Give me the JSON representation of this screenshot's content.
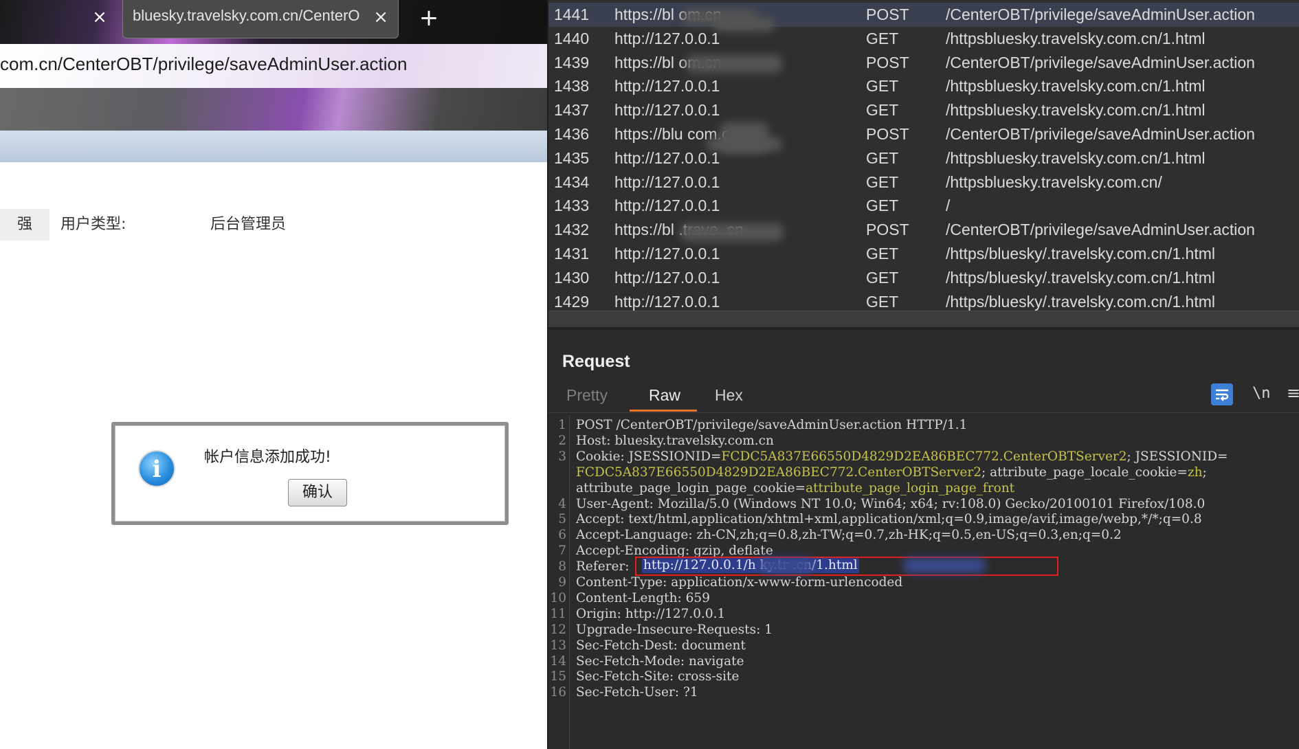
{
  "browser": {
    "tab_close_glyph": "×",
    "active_tab_title": "bluesky.travelsky.com.cn/CenterOBT/privilege/saveAdminUser.action",
    "active_tab_close_glyph": "×",
    "new_tab_glyph": "+",
    "url": "com.cn/CenterOBT/privilege/saveAdminUser.action",
    "form": {
      "left_label": "强",
      "label": "用户类型:",
      "value": "后台管理员"
    },
    "dialog": {
      "icon_glyph": "i",
      "message": "帐户信息添加成功!",
      "ok_label": "确认"
    }
  },
  "burp": {
    "history": [
      {
        "id": "1441",
        "host": "https://bl            om.cn",
        "method": "POST",
        "path": "/CenterOBT/privilege/saveAdminUser.action",
        "selected": true
      },
      {
        "id": "1440",
        "host": "http://127.0.0.1",
        "method": "GET",
        "path": "/httpsbluesky.travelsky.com.cn/1.html"
      },
      {
        "id": "1439",
        "host": "https://bl             om.cn",
        "method": "POST",
        "path": "/CenterOBT/privilege/saveAdminUser.action"
      },
      {
        "id": "1438",
        "host": "http://127.0.0.1",
        "method": "GET",
        "path": "/httpsbluesky.travelsky.com.cn/1.html"
      },
      {
        "id": "1437",
        "host": "http://127.0.0.1",
        "method": "GET",
        "path": "/httpsbluesky.travelsky.com.cn/1.html"
      },
      {
        "id": "1436",
        "host": "https://blu            com.cn",
        "method": "POST",
        "path": "/CenterOBT/privilege/saveAdminUser.action"
      },
      {
        "id": "1435",
        "host": "http://127.0.0.1",
        "method": "GET",
        "path": "/httpsbluesky.travelsky.com.cn/1.html"
      },
      {
        "id": "1434",
        "host": "http://127.0.0.1",
        "method": "GET",
        "path": "/httpsbluesky.travelsky.com.cn/"
      },
      {
        "id": "1433",
        "host": "http://127.0.0.1",
        "method": "GET",
        "path": "/"
      },
      {
        "id": "1432",
        "host": "https://bl      .trave      .cn",
        "method": "POST",
        "path": "/CenterOBT/privilege/saveAdminUser.action"
      },
      {
        "id": "1431",
        "host": "http://127.0.0.1",
        "method": "GET",
        "path": "/https/bluesky/.travelsky.com.cn/1.html"
      },
      {
        "id": "1430",
        "host": "http://127.0.0.1",
        "method": "GET",
        "path": "/https/bluesky/.travelsky.com.cn/1.html"
      },
      {
        "id": "1429",
        "host": "http://127.0.0.1",
        "method": "GET",
        "path": "/https/bluesky/.travelsky.com.cn/1.html"
      }
    ],
    "request_title": "Request",
    "tabs": {
      "pretty": "Pretty",
      "raw": "Raw",
      "hex": "Hex"
    },
    "newline_toggle": "\\n",
    "menu_glyph": "≡",
    "raw_lines": [
      {
        "n": "1",
        "k": "POST /CenterOBT/privilege/saveAdminUser.action HTTP/1.1"
      },
      {
        "n": "2",
        "k": "Host: ",
        "v": "bluesky.travelsky.com.cn"
      },
      {
        "n": "3",
        "k": "Cookie: ",
        "cn1": "JSESSIONID=",
        "cv1": "FCDC5A837E66550D4829D2EA86BEC772.CenterOBTServer2",
        "cn2": "; JSESSIONID="
      },
      {
        "n": "",
        "cv1": "FCDC5A837E66550D4829D2EA86BEC772.CenterOBTServer2",
        "cn2": "; attribute_page_locale_cookie=",
        "cv2": "zh",
        "cn3": ";"
      },
      {
        "n": "",
        "cn1": "attribute_page_login_page_cookie=",
        "cv1": "attribute_page_login_page_front"
      },
      {
        "n": "4",
        "k": "User-Agent: ",
        "v": "Mozilla/5.0 (Windows NT 10.0; Win64; x64; rv:108.0) Gecko/20100101 Firefox/108.0"
      },
      {
        "n": "5",
        "k": "Accept: ",
        "v": "text/html,application/xhtml+xml,application/xml;q=0.9,image/avif,image/webp,*/*;q=0.8"
      },
      {
        "n": "6",
        "k": "Accept-Language: ",
        "v": "zh-CN,zh;q=0.8,zh-TW;q=0.7,zh-HK;q=0.5,en-US;q=0.3,en;q=0.2"
      },
      {
        "n": "7",
        "k": "Accept-Encoding: ",
        "v": "gzip, deflate"
      },
      {
        "n": "8",
        "k": "Referer: ",
        "ref": "http://127.0.0.1/h          ky.tr                 .cn/1.html"
      },
      {
        "n": "9",
        "k": "Content-Type: ",
        "v": "application/x-www-form-urlencoded"
      },
      {
        "n": "10",
        "k": "Content-Length: ",
        "v": "659"
      },
      {
        "n": "11",
        "k": "Origin: ",
        "v": "http://127.0.0.1"
      },
      {
        "n": "12",
        "k": "Upgrade-Insecure-Requests: ",
        "v": "1"
      },
      {
        "n": "13",
        "k": "Sec-Fetch-Dest: ",
        "v": "document"
      },
      {
        "n": "14",
        "k": "Sec-Fetch-Mode: ",
        "v": "navigate"
      },
      {
        "n": "15",
        "k": "Sec-Fetch-Site: ",
        "v": "cross-site"
      },
      {
        "n": "16",
        "k": "Sec-Fetch-User: ",
        "v": "?1"
      }
    ],
    "colors": {
      "accent_orange": "#e8742c",
      "cookie_value": "#c7c24a",
      "selection": "#2d3d8c",
      "highlight_box": "#e02020",
      "wrap_button": "#3d7fd6"
    }
  }
}
